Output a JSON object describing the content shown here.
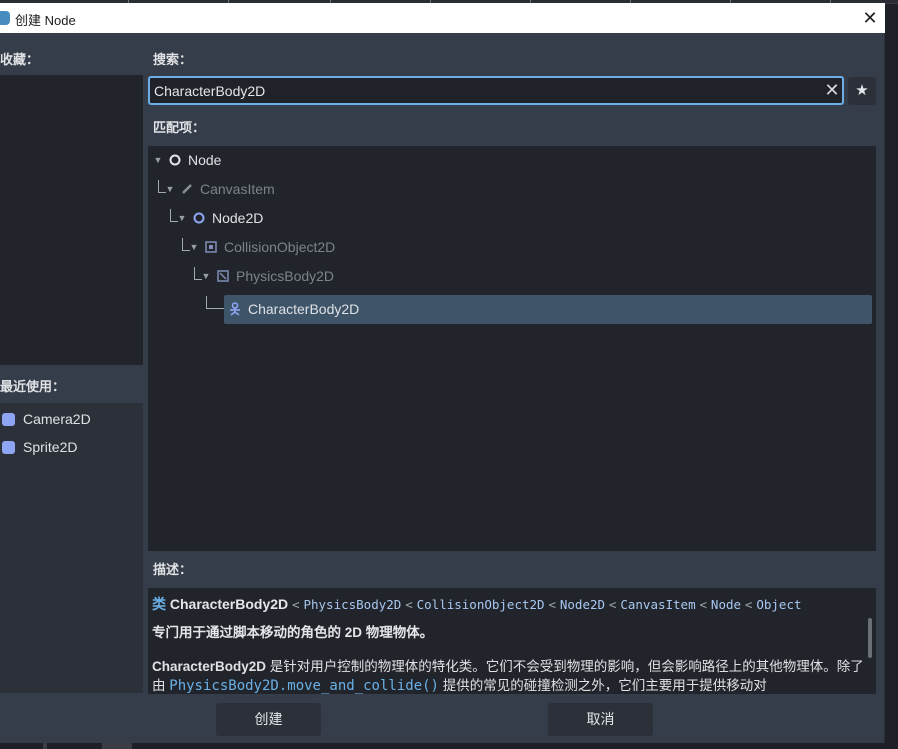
{
  "window": {
    "title": "创建 Node",
    "close": "✕"
  },
  "labels": {
    "favorites": "收藏：",
    "recent": "最近使用：",
    "search": "搜索：",
    "matches": "匹配项：",
    "description": "描述："
  },
  "search": {
    "value": "CharacterBody2D",
    "clear": "✕",
    "favorite_icon": "star-icon"
  },
  "recent": [
    {
      "label": "Camera2D",
      "icon": "camera-icon"
    },
    {
      "label": "Sprite2D",
      "icon": "sprite-icon"
    }
  ],
  "tree": [
    {
      "label": "Node",
      "level": 0,
      "state": "bright",
      "icon": "circle-icon"
    },
    {
      "label": "CanvasItem",
      "level": 1,
      "state": "dim",
      "icon": "brush-icon"
    },
    {
      "label": "Node2D",
      "level": 2,
      "state": "bright",
      "icon": "circle-icon"
    },
    {
      "label": "CollisionObject2D",
      "level": 3,
      "state": "dim",
      "icon": "square-icon"
    },
    {
      "label": "PhysicsBody2D",
      "level": 4,
      "state": "dim",
      "icon": "body-icon"
    },
    {
      "label": "CharacterBody2D",
      "level": 5,
      "state": "selected",
      "icon": "character-icon"
    }
  ],
  "desc": {
    "prefix": "类",
    "class": "CharacterBody2D",
    "inherits": [
      "PhysicsBody2D",
      "CollisionObject2D",
      "Node2D",
      "CanvasItem",
      "Node",
      "Object"
    ],
    "separator": "<",
    "brief": "专门用于通过脚本移动的角色的 2D 物理物体。",
    "body_class": "CharacterBody2D",
    "body_text1": " 是针对用户控制的物理体的特化类。它们不会受到物理的影响，但会影响路径上的其他物理体。除了由 ",
    "body_link": "PhysicsBody2D.move_and_collide()",
    "body_text2": " 提供的常见的碰撞检测之外，它们主要用于提供移动对"
  },
  "buttons": {
    "create": "创建",
    "cancel": "取消"
  },
  "colors": {
    "accent": "#6ab0e6",
    "selection": "#3e5469",
    "node_icon": "#8da5f3"
  }
}
